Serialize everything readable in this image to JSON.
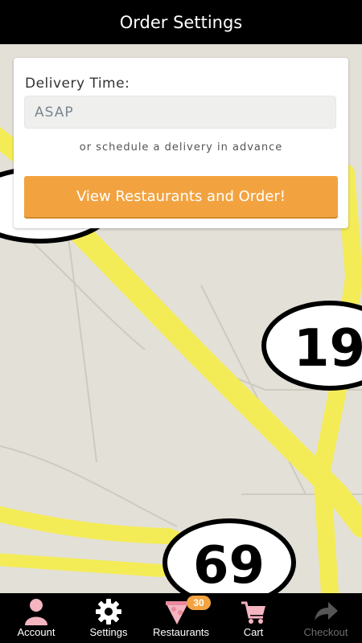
{
  "header": {
    "title": "Order Settings"
  },
  "order_form": {
    "delivery_label": "Delivery Time:",
    "delivery_value": "ASAP",
    "schedule_hint": "or schedule a delivery in advance",
    "cta_label": "View Restaurants and Order!"
  },
  "map": {
    "shield_labels": [
      "19",
      "69"
    ]
  },
  "tabbar": {
    "account": "Account",
    "settings": "Settings",
    "restaurants": "Restaurants",
    "restaurants_badge": "30",
    "cart": "Cart",
    "checkout": "Checkout"
  },
  "colors": {
    "accent": "#f2a340",
    "header_bg": "#000000",
    "tab_icon_pink": "#f4b4c0",
    "road_yellow": "#f3ec57"
  },
  "icons": [
    "person-icon",
    "gear-icon",
    "pizza-icon",
    "cart-icon",
    "arrow-forward-icon"
  ]
}
